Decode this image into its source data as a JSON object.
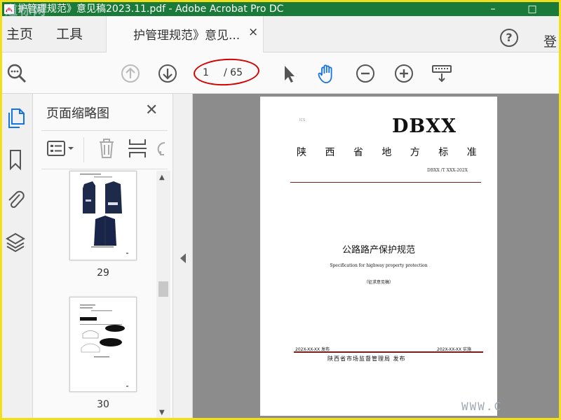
{
  "window": {
    "title": "护管理规范》意见稿2023.11.pdf - Adobe Acrobat Pro DC",
    "watermark_text": "道标网",
    "minimize": "–",
    "maximize": "□"
  },
  "menubar": {
    "home": "主页",
    "tools": "工具",
    "tab_label": "护管理规范》意见...",
    "tab_close": "×",
    "help": "?",
    "login": "登"
  },
  "toolbar": {
    "current_page": "1",
    "total_pages": "/ 65",
    "icons": [
      "search-icon",
      "page-up-icon",
      "page-down-icon",
      "select-arrow-icon",
      "hand-tool-icon",
      "zoom-out-icon",
      "zoom-in-icon",
      "keyboard-icon"
    ]
  },
  "panel": {
    "title": "页面缩略图",
    "close": "✕",
    "thumbnails": [
      {
        "page": "29"
      },
      {
        "page": "30"
      }
    ]
  },
  "document": {
    "logo_text": "ICS",
    "dbxx": "DBXX",
    "standard_type": "陕 西 省 地 方 标 准",
    "code": "DBXX /T XXX-202X",
    "title_cn": "公路路产保护规范",
    "title_en": "Specification for highway property protection",
    "draft": "（征求意见稿）",
    "release_date": "202X-XX-XX 发布",
    "impl_date": "202X-XX-XX 实施",
    "issuer": "陕西省市场监督管理局  发布"
  },
  "footer_watermark": "WWW.C",
  "colors": {
    "titlebar": "#1a7a39",
    "accent_blue": "#1473e6",
    "annotation_red": "#d60000",
    "outer_border": "#f2df1c"
  }
}
